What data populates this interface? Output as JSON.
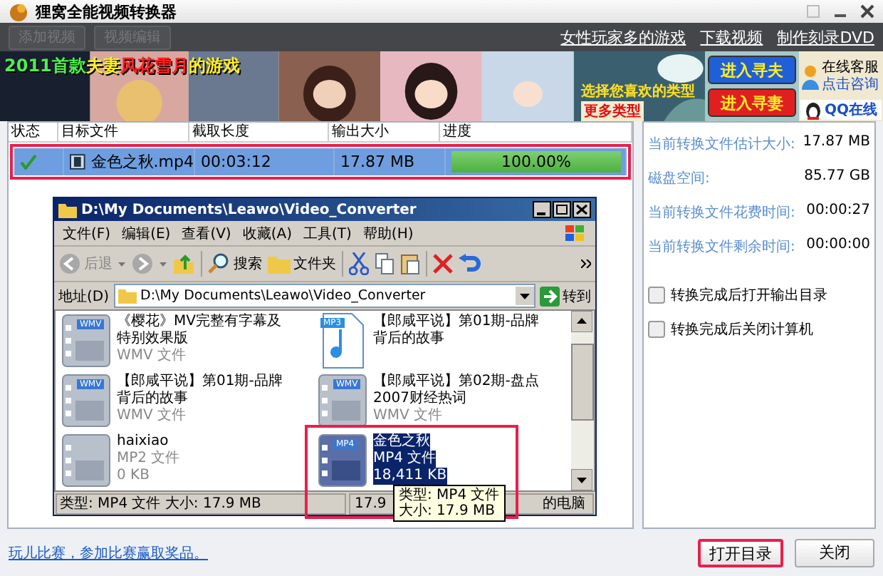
{
  "window": {
    "title": "狸窝全能视频转换器"
  },
  "toolbar": {
    "buttons": [
      {
        "label": "添加视频",
        "disabled": true
      },
      {
        "label": "视频编辑",
        "disabled": true
      }
    ],
    "links": [
      "女性玩家多的游戏",
      "下载视频",
      "制作刻录DVD"
    ]
  },
  "banner": {
    "headline": [
      {
        "text": "2011首款",
        "color": "#4cf04c"
      },
      {
        "text": "夫妻",
        "color": "#ffee22"
      },
      {
        "text": "风花雪月",
        "color": "#ff2020"
      },
      {
        "text": "的游戏",
        "color": "#ffee22"
      }
    ],
    "tagline": "选择您喜欢的类型",
    "more": "更多类型",
    "buttons": [
      {
        "label": "进入寻夫",
        "color": "#1f5fd8"
      },
      {
        "label": "进入寻妻",
        "color": "#e02020"
      }
    ],
    "service": {
      "title": "在线客服",
      "link": "点击咨询",
      "qq": "QQ在线"
    }
  },
  "table": {
    "columns": [
      "状态",
      "目标文件",
      "截取长度",
      "输出大小",
      "进度"
    ],
    "rows": [
      {
        "selected": true,
        "highlighted": true,
        "done": true,
        "file": "金色之秋.mp4",
        "length": "00:03:12",
        "size": "17.87 MB",
        "level": 1,
        "progress": "100.00%"
      }
    ]
  },
  "explorer": {
    "title": "D:\\My Documents\\Leawo\\Video_Converter",
    "menu": [
      "文件(F)",
      "编辑(E)",
      "查看(V)",
      "收藏(A)",
      "工具(T)",
      "帮助(H)"
    ],
    "back": "后退",
    "search": "搜索",
    "folders": "文件夹",
    "address": {
      "label": "地址(D)",
      "value": "D:\\My Documents\\Leawo\\Video_Converter",
      "go": "转到"
    },
    "files": [
      {
        "kind": "video",
        "badge": "WMV",
        "name": "《樱花》MV完整有字幕及特别效果版",
        "type": "WMV 文件",
        "selected": false,
        "highlighted": false
      },
      {
        "kind": "audio",
        "badge": "MP3",
        "name": "【郎咸平说】第01期-品牌背后的故事",
        "selected": false,
        "highlighted": false
      },
      {
        "kind": "video",
        "badge": "WMV",
        "name": "【郎咸平说】第01期-品牌背后的故事",
        "type": "WMV 文件",
        "selected": false,
        "highlighted": false
      },
      {
        "kind": "video",
        "badge": "WMV",
        "name": "【郎咸平说】第02期-盘点2007财经热词",
        "type": "WMV 文件",
        "selected": false,
        "highlighted": false
      },
      {
        "kind": "video",
        "name": "haixiao",
        "type": "MP2 文件",
        "size": "0 KB",
        "selected": false,
        "highlighted": false
      },
      {
        "kind": "video",
        "badge": "MP4",
        "name": "金色之秋",
        "type": "MP4 文件",
        "size": "18,411 KB",
        "selected": true,
        "highlighted": true
      }
    ],
    "status": [
      "类型: MP4 文件 大小: 17.9 MB",
      "17.9",
      "的电脑"
    ],
    "tooltip": [
      "类型: MP4 文件",
      "大小: 17.9 MB"
    ]
  },
  "info": {
    "stats": [
      {
        "label": "当前转换文件估计大小:",
        "value": "17.87 MB"
      },
      {
        "label": "磁盘空间:",
        "value": "85.77 GB"
      },
      {
        "label": "当前转换文件花费时间:",
        "value": "00:00:27"
      },
      {
        "label": "当前转换文件剩余时间:",
        "value": "00:00:00"
      }
    ],
    "options": [
      {
        "label": "转换完成后打开输出目录",
        "checked": false
      },
      {
        "label": "转换完成后关闭计算机",
        "checked": false
      }
    ]
  },
  "footer": {
    "link": "玩儿比赛，参加比赛赢取奖品。",
    "buttons": [
      {
        "label": "打开目录",
        "highlighted": true
      },
      {
        "label": "关闭",
        "highlighted": false
      }
    ]
  }
}
